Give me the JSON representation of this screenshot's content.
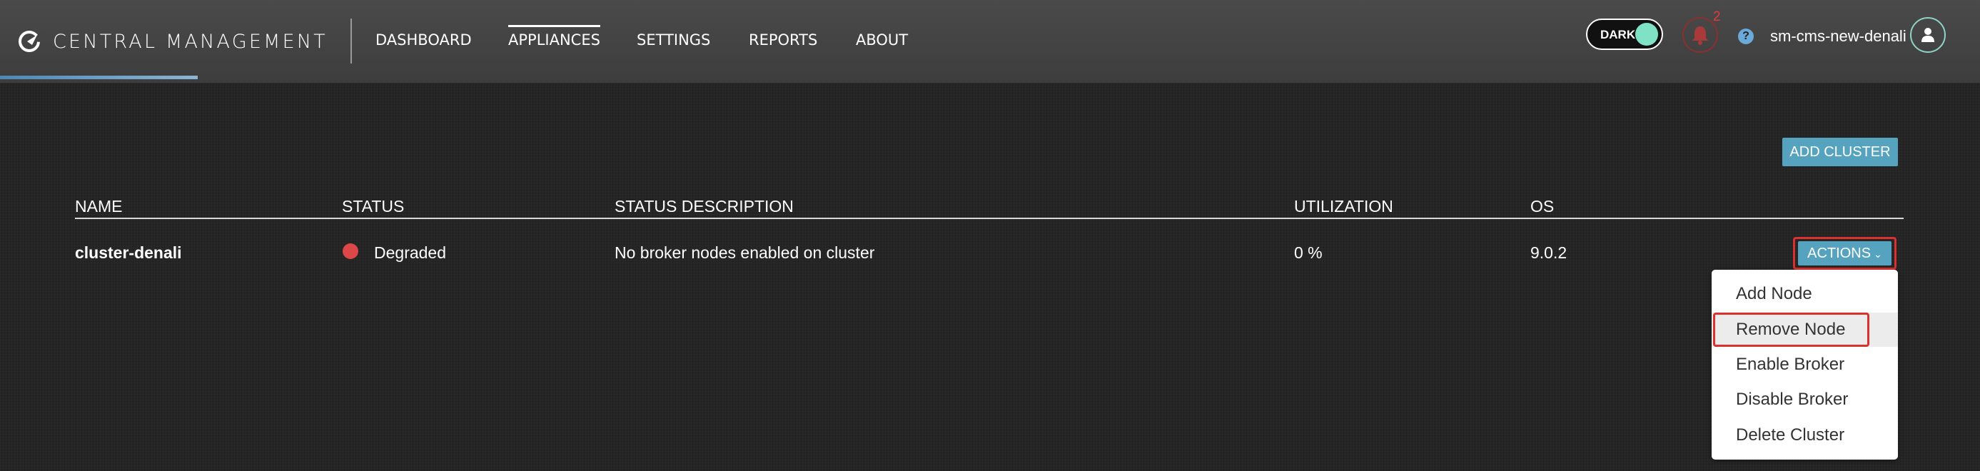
{
  "brand": {
    "name": "CENTRAL MANAGEMENT",
    "logo_icon": "circle-arrow-logo-icon"
  },
  "nav": [
    {
      "label": "DASHBOARD",
      "active": false
    },
    {
      "label": "APPLIANCES",
      "active": true
    },
    {
      "label": "SETTINGS",
      "active": false
    },
    {
      "label": "REPORTS",
      "active": false
    },
    {
      "label": "ABOUT",
      "active": false
    }
  ],
  "page_progress": 0.1,
  "header": {
    "theme_toggle": {
      "label": "DARK",
      "on": true
    },
    "notifications": {
      "icon": "bell-icon",
      "count": "2"
    },
    "help_icon": "question-circle-icon",
    "help_glyph": "?",
    "user": {
      "name": "sm-cms-new-denali",
      "icon": "user-icon"
    }
  },
  "main": {
    "add_cluster_label": "ADD CLUSTER",
    "table": {
      "columns": [
        "NAME",
        "STATUS",
        "STATUS DESCRIPTION",
        "UTILIZATION",
        "OS"
      ],
      "rows": [
        {
          "name": "cluster-denali",
          "status": "Degraded",
          "status_color": "#dc4848",
          "status_description": "No broker nodes enabled on cluster",
          "utilization": "0 %",
          "os": "9.0.2"
        }
      ]
    },
    "actions_label": "ACTIONS",
    "actions_menu": [
      "Add Node",
      "Remove Node",
      "Enable Broker",
      "Disable Broker",
      "Delete Cluster"
    ]
  },
  "colors": {
    "accent": "#56a3bf",
    "highlight_outline": "#d8312e",
    "toggle_knob": "#7fe2c4",
    "alert": "#e23a3a"
  }
}
